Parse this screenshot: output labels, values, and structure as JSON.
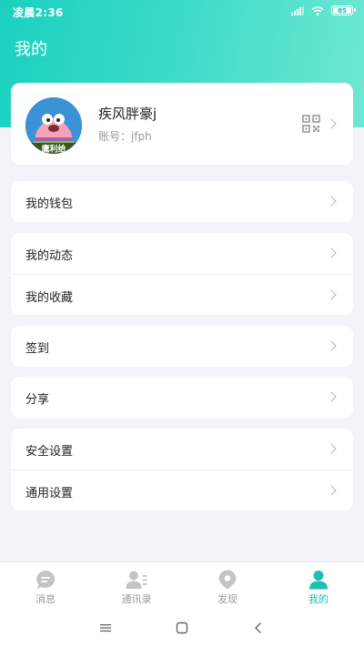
{
  "status_bar": {
    "time": "凌晨2:36",
    "battery": "85"
  },
  "header": {
    "title": "我的"
  },
  "profile": {
    "username": "疾风胖豪j",
    "account": "账号：jfph",
    "avatar_caption": "鹰利给"
  },
  "menu": [
    {
      "items": [
        {
          "label": "我的钱包"
        }
      ]
    },
    {
      "items": [
        {
          "label": "我的动态"
        },
        {
          "label": "我的收藏"
        }
      ]
    },
    {
      "items": [
        {
          "label": "签到"
        }
      ]
    },
    {
      "items": [
        {
          "label": "分享"
        }
      ]
    },
    {
      "items": [
        {
          "label": "安全设置"
        },
        {
          "label": "通用设置"
        }
      ]
    }
  ],
  "tabs": [
    {
      "label": "消息",
      "icon": "message-icon",
      "active": false
    },
    {
      "label": "通讯录",
      "icon": "contacts-icon",
      "active": false
    },
    {
      "label": "发现",
      "icon": "location-pin-icon",
      "active": false
    },
    {
      "label": "我的",
      "icon": "person-icon",
      "active": true
    }
  ],
  "colors": {
    "accent": "#1dbfb0",
    "inactive": "#bcbcbc",
    "header_start": "#1ad0c0",
    "header_end": "#6ee8d2"
  }
}
